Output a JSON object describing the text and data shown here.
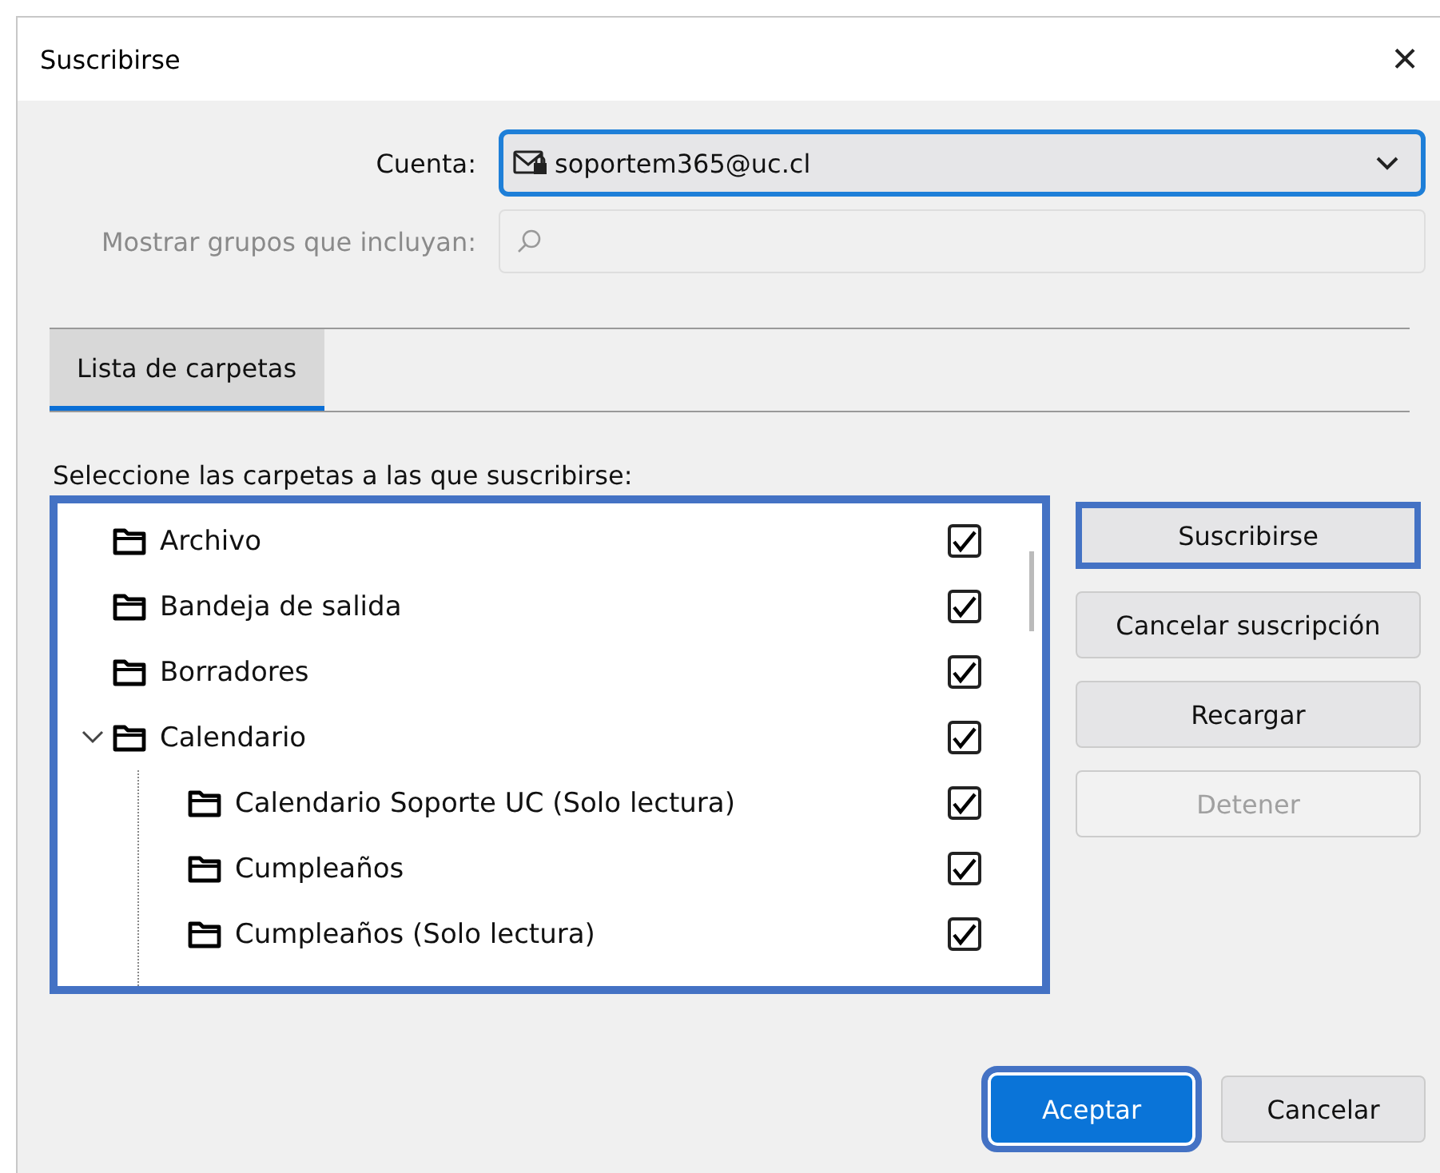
{
  "window": {
    "title": "Suscribirse",
    "close": "×"
  },
  "account": {
    "label": "Cuenta:",
    "value": "soportem365@uc.cl",
    "focused": true
  },
  "filter": {
    "label": "Mostrar grupos que incluyan:",
    "disabled": true
  },
  "tabs": [
    {
      "label": "Lista de carpetas",
      "selected": true
    }
  ],
  "list": {
    "label": "Seleccione las carpetas a las que suscribirse:",
    "highlighted": true,
    "items": [
      {
        "name": "Archivo",
        "checked": true
      },
      {
        "name": "Bandeja de salida",
        "checked": true
      },
      {
        "name": "Borradores",
        "checked": true
      },
      {
        "name": "Calendario",
        "checked": true,
        "expanded": true,
        "children": [
          {
            "name": "Calendario Soporte UC (Solo lectura)",
            "checked": true
          },
          {
            "name": "Cumpleaños",
            "checked": true
          },
          {
            "name": "Cumpleaños (Solo lectura)",
            "checked": true
          }
        ]
      }
    ]
  },
  "side_buttons": [
    {
      "label": "Suscribirse",
      "disabled": false,
      "highlighted": true
    },
    {
      "label": "Cancelar suscripción",
      "disabled": false,
      "highlighted": false
    },
    {
      "label": "Recargar",
      "disabled": false,
      "highlighted": false
    },
    {
      "label": "Detener",
      "disabled": true,
      "highlighted": false
    }
  ],
  "footer_buttons": [
    {
      "label": "Aceptar",
      "primary": true,
      "highlighted": true
    },
    {
      "label": "Cancelar",
      "primary": false,
      "highlighted": false
    }
  ]
}
